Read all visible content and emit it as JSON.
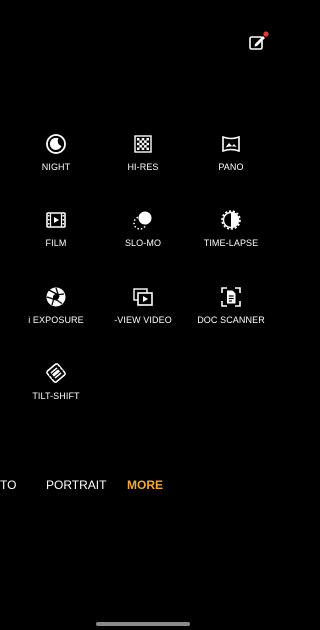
{
  "modes": {
    "night": "NIGHT",
    "hires": "HI-RES",
    "pano": "PANO",
    "film": "FILM",
    "slomo": "SLO-MO",
    "timelapse": "TIME-LAPSE",
    "exposure": "i EXPOSURE",
    "dualview": "-VIEW VIDEO",
    "docscanner": "DOC SCANNER",
    "tiltshift": "TILT-SHIFT"
  },
  "tabs": {
    "photo_partial": "TO",
    "portrait": "PORTRAIT",
    "more": "MORE"
  },
  "colors": {
    "accent": "#f2a93b",
    "notification_dot": "#e53935"
  },
  "icons": {
    "edit": "edit-icon",
    "night": "moon-icon",
    "hires": "hi-res-icon",
    "pano": "panorama-icon",
    "film": "film-icon",
    "slomo": "slo-mo-icon",
    "timelapse": "time-lapse-icon",
    "exposure": "aperture-icon",
    "dualview": "dual-view-icon",
    "docscanner": "doc-scanner-icon",
    "tiltshift": "tilt-shift-icon"
  }
}
